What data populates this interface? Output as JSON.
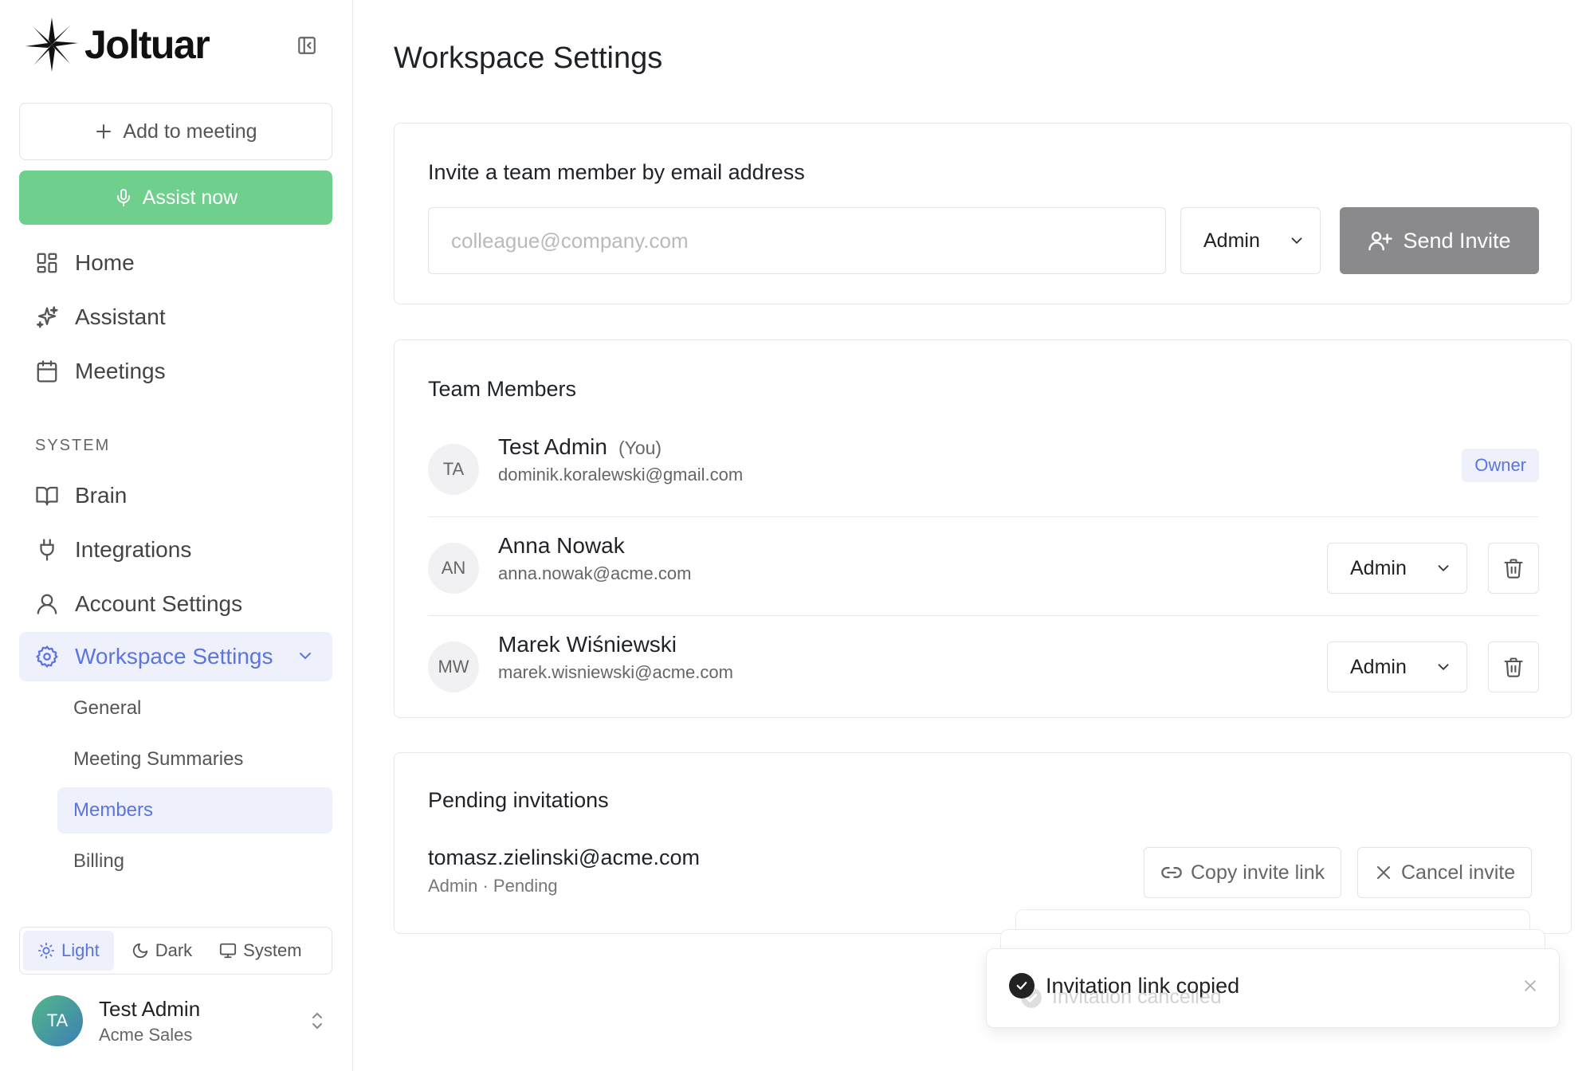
{
  "brand": {
    "name": "Joltuar"
  },
  "sidebar": {
    "add_button": "Add to meeting",
    "assist_button": "Assist now",
    "nav": [
      {
        "label": "Home",
        "icon": "grid-icon"
      },
      {
        "label": "Assistant",
        "icon": "sparkles-icon"
      },
      {
        "label": "Meetings",
        "icon": "calendar-icon"
      }
    ],
    "system_label": "SYSTEM",
    "system_nav": [
      {
        "label": "Brain",
        "icon": "book-icon"
      },
      {
        "label": "Integrations",
        "icon": "plug-icon"
      },
      {
        "label": "Account Settings",
        "icon": "user-icon"
      },
      {
        "label": "Workspace Settings",
        "icon": "gear-icon",
        "active": true,
        "expanded": true
      }
    ],
    "workspace_sub": [
      {
        "label": "General"
      },
      {
        "label": "Meeting Summaries"
      },
      {
        "label": "Members",
        "active": true
      },
      {
        "label": "Billing"
      }
    ],
    "theme": {
      "light": "Light",
      "dark": "Dark",
      "system": "System",
      "selected": "Light"
    },
    "user": {
      "initials": "TA",
      "name": "Test Admin",
      "org": "Acme Sales"
    }
  },
  "main": {
    "title": "Workspace Settings",
    "invite": {
      "heading": "Invite a team member by email address",
      "placeholder": "colleague@company.com",
      "role": "Admin",
      "send_label": "Send Invite"
    },
    "team": {
      "heading": "Team Members",
      "members": [
        {
          "initials": "TA",
          "name": "Test Admin",
          "you": "(You)",
          "email": "dominik.koralewski@gmail.com",
          "badge": "Owner"
        },
        {
          "initials": "AN",
          "name": "Anna Nowak",
          "email": "anna.nowak@acme.com",
          "role": "Admin"
        },
        {
          "initials": "MW",
          "name": "Marek Wiśniewski",
          "email": "marek.wisniewski@acme.com",
          "role": "Admin"
        }
      ]
    },
    "pending": {
      "heading": "Pending invitations",
      "items": [
        {
          "email": "tomasz.zielinski@acme.com",
          "meta": "Admin · Pending",
          "copy_label": "Copy invite link",
          "cancel_label": "Cancel invite"
        }
      ]
    }
  },
  "toasts": {
    "front": "Invitation link copied",
    "behind": "Invitation cancelled"
  },
  "colors": {
    "accent": "#5b74e0",
    "accent_bg": "#eef1fb",
    "assist_green": "#6fcf8d",
    "send_disabled": "#8a8a8c"
  }
}
